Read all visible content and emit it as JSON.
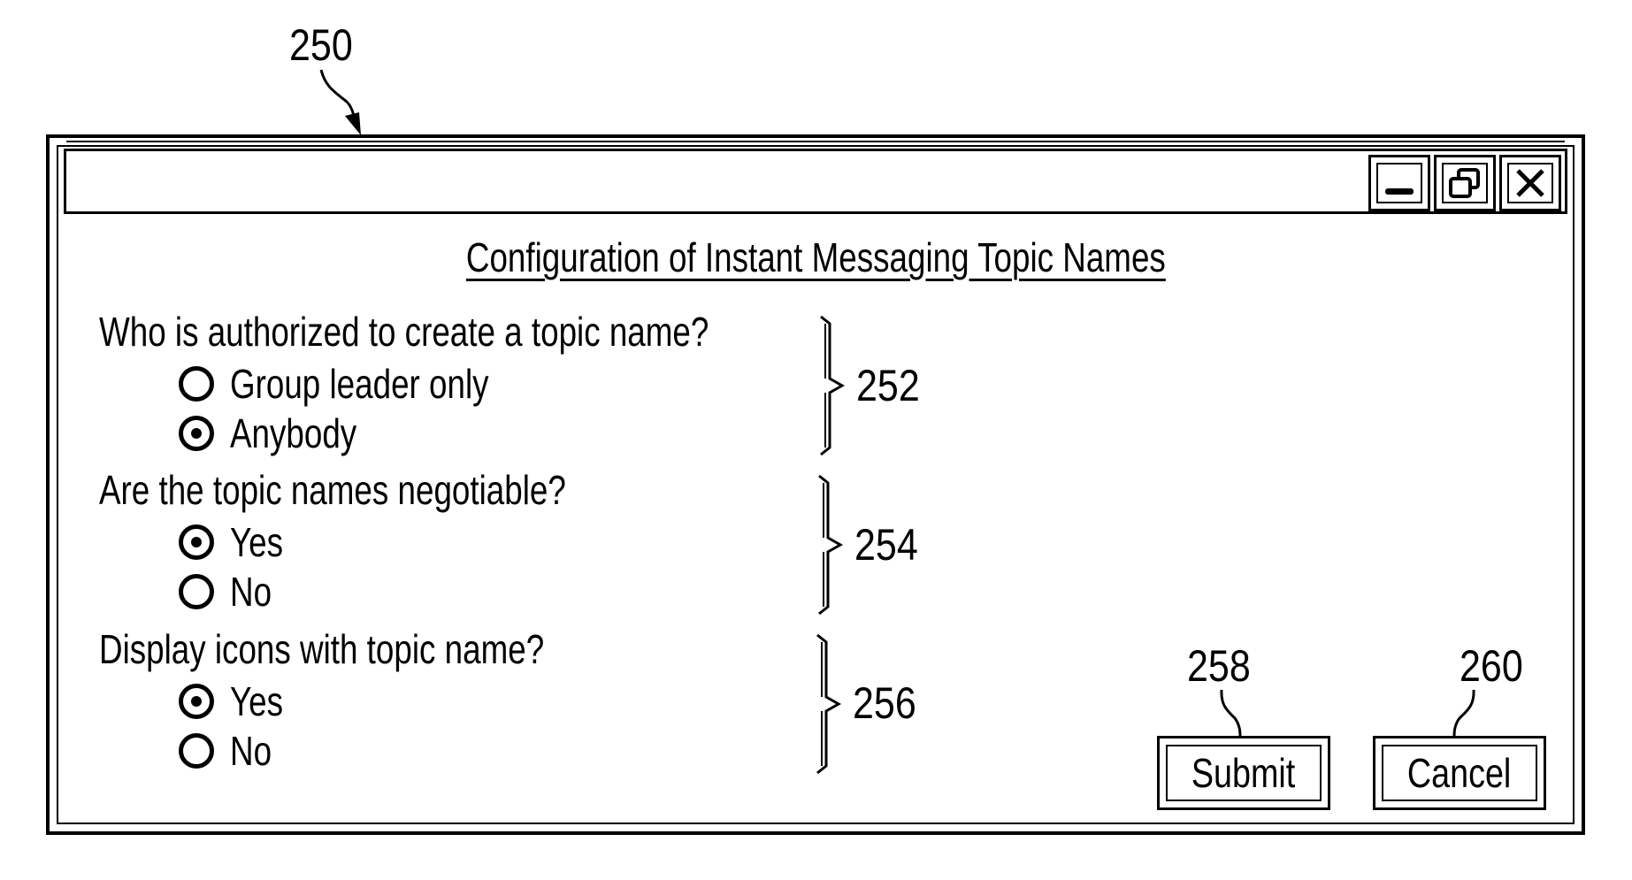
{
  "figure": {
    "window_ref": "250",
    "window_title": "",
    "titlebar_buttons": [
      {
        "name": "minimize",
        "icon": "minimize-icon"
      },
      {
        "name": "restore",
        "icon": "restore-icon"
      },
      {
        "name": "close",
        "icon": "close-icon"
      }
    ],
    "dialog_title": "Configuration of Instant Messaging Topic Names",
    "questions": [
      {
        "ref": "252",
        "text": "Who is authorized to create a topic name?",
        "options": [
          {
            "label": "Group leader only",
            "selected": false
          },
          {
            "label": "Anybody",
            "selected": true
          }
        ]
      },
      {
        "ref": "254",
        "text": "Are the topic names negotiable?",
        "options": [
          {
            "label": "Yes",
            "selected": true
          },
          {
            "label": "No",
            "selected": false
          }
        ]
      },
      {
        "ref": "256",
        "text": "Display icons with topic name?",
        "options": [
          {
            "label": "Yes",
            "selected": true
          },
          {
            "label": "No",
            "selected": false
          }
        ]
      }
    ],
    "buttons": {
      "submit": {
        "label": "Submit",
        "ref": "258"
      },
      "cancel": {
        "label": "Cancel",
        "ref": "260"
      }
    }
  }
}
